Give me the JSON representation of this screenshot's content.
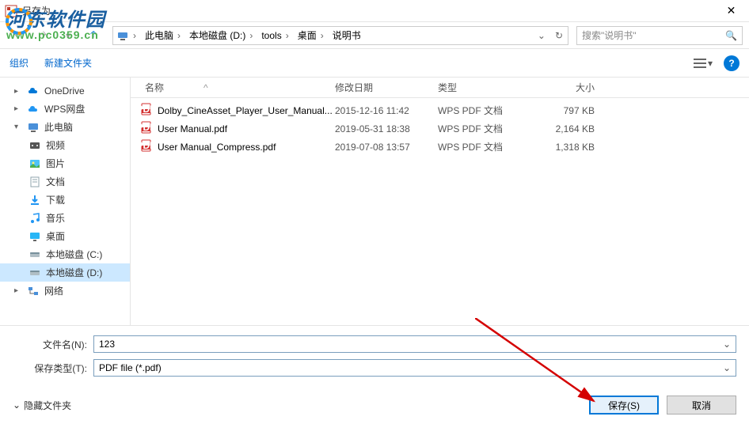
{
  "window": {
    "title": "另存为"
  },
  "watermark": {
    "text": "河东软件园",
    "url": "www.pc0359.cn"
  },
  "breadcrumb": {
    "items": [
      "此电脑",
      "本地磁盘 (D:)",
      "tools",
      "桌面",
      "说明书"
    ]
  },
  "search": {
    "placeholder": "搜索\"说明书\""
  },
  "toolbar": {
    "organize": "组织",
    "newfolder": "新建文件夹"
  },
  "sidebar": {
    "items": [
      {
        "icon": "cloud-blue",
        "label": "OneDrive",
        "caret": "▸"
      },
      {
        "icon": "cloud-wps",
        "label": "WPS网盘",
        "caret": "▸"
      },
      {
        "icon": "pc",
        "label": "此电脑",
        "caret": "▾"
      },
      {
        "icon": "video",
        "label": "视频",
        "indent": true
      },
      {
        "icon": "image",
        "label": "图片",
        "indent": true
      },
      {
        "icon": "doc",
        "label": "文档",
        "indent": true
      },
      {
        "icon": "download",
        "label": "下载",
        "indent": true
      },
      {
        "icon": "music",
        "label": "音乐",
        "indent": true
      },
      {
        "icon": "desktop",
        "label": "桌面",
        "indent": true
      },
      {
        "icon": "disk",
        "label": "本地磁盘 (C:)",
        "indent": true
      },
      {
        "icon": "disk",
        "label": "本地磁盘 (D:)",
        "indent": true,
        "active": true
      },
      {
        "icon": "network",
        "label": "网络",
        "caret": "▸"
      }
    ]
  },
  "columns": {
    "name": "名称",
    "date": "修改日期",
    "type": "类型",
    "size": "大小"
  },
  "files": [
    {
      "name": "Dolby_CineAsset_Player_User_Manual...",
      "date": "2015-12-16 11:42",
      "type": "WPS PDF 文档",
      "size": "797 KB"
    },
    {
      "name": "User Manual.pdf",
      "date": "2019-05-31 18:38",
      "type": "WPS PDF 文档",
      "size": "2,164 KB"
    },
    {
      "name": "User Manual_Compress.pdf",
      "date": "2019-07-08 13:57",
      "type": "WPS PDF 文档",
      "size": "1,318 KB"
    }
  ],
  "filename": {
    "label": "文件名(N):",
    "value": "123"
  },
  "filetype": {
    "label": "保存类型(T):",
    "value": "PDF file (*.pdf)"
  },
  "footer": {
    "hide": "隐藏文件夹",
    "save": "保存(S)",
    "cancel": "取消"
  }
}
